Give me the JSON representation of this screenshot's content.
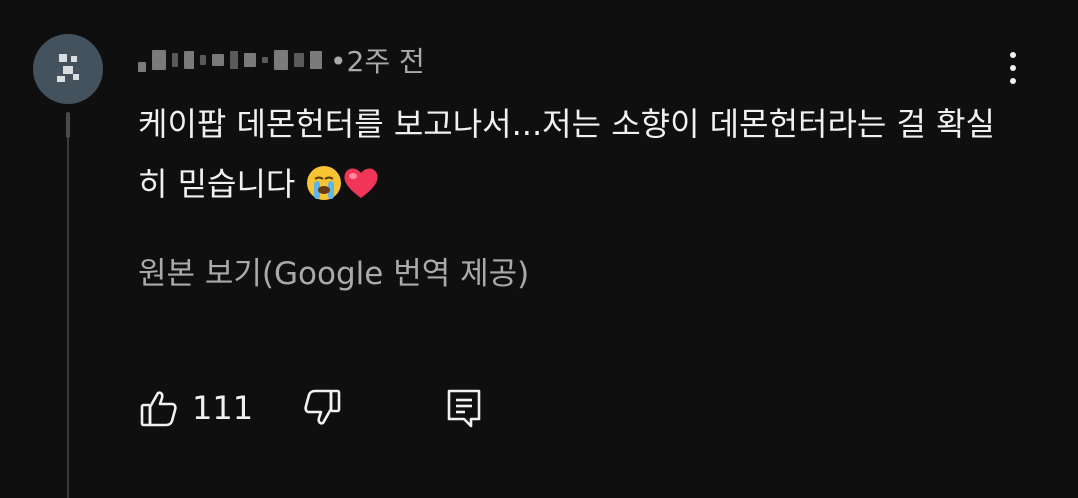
{
  "comment": {
    "time": "•2주 전",
    "text": "케이팝 데몬헌터를 보고나서...저는 소향이 데몬헌터라는 걸 확실히 믿습니다",
    "emoji_names": [
      "loudly-crying-face-icon",
      "red-heart-icon"
    ],
    "translate_link": "원본 보기(Google 번역 제공)",
    "like_count": "111"
  },
  "icons": {
    "more": "more-vertical-icon",
    "like": "thumbs-up-icon",
    "dislike": "thumbs-down-icon",
    "reply": "reply-comment-icon"
  },
  "colors": {
    "background": "#0f0f0f",
    "text": "#f1f1f1",
    "secondary_text": "#aaaaaa"
  }
}
